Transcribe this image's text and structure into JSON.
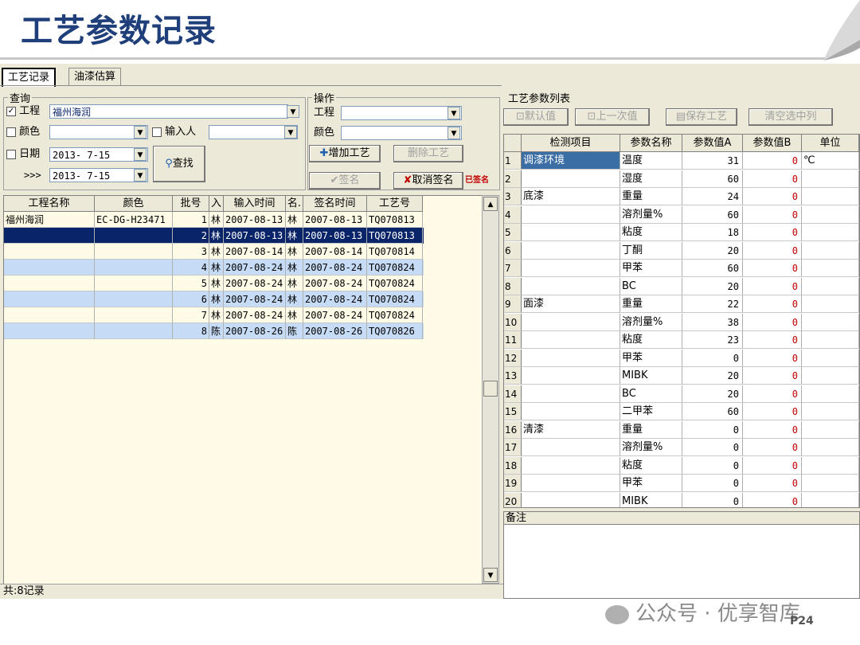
{
  "slide": {
    "title": "工艺参数记录",
    "page": "P24",
    "watermark": "公众号 · 优享智库"
  },
  "tabs": [
    {
      "label": "工艺记录",
      "active": true
    },
    {
      "label": "油漆估算",
      "active": false
    }
  ],
  "query": {
    "legend": "查询",
    "project_label": "工程",
    "project_checked": true,
    "project_value": "福州海润",
    "color_label": "颜色",
    "color_value": "",
    "input_person_label": "输入人",
    "input_person_value": "",
    "date_label": "日期",
    "date_from": "2013- 7-15",
    "date_to_prefix": ">>>",
    "date_to": "2013- 7-15",
    "search_button": "查找"
  },
  "ops": {
    "legend": "操作",
    "project_label": "工程",
    "project_value": "",
    "color_label": "颜色",
    "color_value": "",
    "add_button": "增加工艺",
    "delete_button": "删除工艺",
    "sign_button": "签名",
    "cancel_sign_button": "取消签名",
    "stamp_text": "已签名"
  },
  "left_grid": {
    "columns": [
      "工程名称",
      "颜色",
      "批号",
      "入",
      "输入时间",
      "名.",
      "签名时间",
      "工艺号"
    ],
    "rows": [
      [
        "福州海润",
        "EC-DG-H23471",
        "1",
        "林",
        "2007-08-13",
        "林",
        "2007-08-13",
        "TQ070813"
      ],
      [
        "",
        "",
        "2",
        "林",
        "2007-08-13",
        "林",
        "2007-08-13",
        "TQ070813"
      ],
      [
        "",
        "",
        "3",
        "林",
        "2007-08-14",
        "林",
        "2007-08-14",
        "TQ070814"
      ],
      [
        "",
        "",
        "4",
        "林",
        "2007-08-24",
        "林",
        "2007-08-24",
        "TQ070824"
      ],
      [
        "",
        "",
        "5",
        "林",
        "2007-08-24",
        "林",
        "2007-08-24",
        "TQ070824"
      ],
      [
        "",
        "",
        "6",
        "林",
        "2007-08-24",
        "林",
        "2007-08-24",
        "TQ070824"
      ],
      [
        "",
        "",
        "7",
        "林",
        "2007-08-24",
        "林",
        "2007-08-24",
        "TQ070824"
      ],
      [
        "",
        "",
        "8",
        "陈",
        "2007-08-26",
        "陈",
        "2007-08-26",
        "TQ070826"
      ]
    ],
    "selected_row": 2
  },
  "status": "共:8记录",
  "param_list": {
    "legend": "工艺参数列表",
    "default_button": "默认值",
    "previous_button": "上一次值",
    "save_button": "保存工艺",
    "clear_button": "清空选中列",
    "columns": [
      "",
      "检测项目",
      "参数名称",
      "参数值A",
      "参数值B",
      "单位"
    ],
    "rows": [
      [
        "1",
        "调漆环境",
        "温度",
        "31",
        "0",
        "℃"
      ],
      [
        "2",
        "",
        "湿度",
        "60",
        "0",
        ""
      ],
      [
        "3",
        "底漆",
        "重量",
        "24",
        "0",
        ""
      ],
      [
        "4",
        "",
        "溶剂量%",
        "60",
        "0",
        ""
      ],
      [
        "5",
        "",
        "粘度",
        "18",
        "0",
        ""
      ],
      [
        "6",
        "",
        "丁酮",
        "20",
        "0",
        ""
      ],
      [
        "7",
        "",
        "甲苯",
        "60",
        "0",
        ""
      ],
      [
        "8",
        "",
        "BC",
        "20",
        "0",
        ""
      ],
      [
        "9",
        "面漆",
        "重量",
        "22",
        "0",
        ""
      ],
      [
        "10",
        "",
        "溶剂量%",
        "38",
        "0",
        ""
      ],
      [
        "11",
        "",
        "粘度",
        "23",
        "0",
        ""
      ],
      [
        "12",
        "",
        "甲苯",
        "0",
        "0",
        ""
      ],
      [
        "13",
        "",
        "MIBK",
        "20",
        "0",
        ""
      ],
      [
        "14",
        "",
        "BC",
        "20",
        "0",
        ""
      ],
      [
        "15",
        "",
        "二甲苯",
        "60",
        "0",
        ""
      ],
      [
        "16",
        "清漆",
        "重量",
        "0",
        "0",
        ""
      ],
      [
        "17",
        "",
        "溶剂量%",
        "0",
        "0",
        ""
      ],
      [
        "18",
        "",
        "粘度",
        "0",
        "0",
        ""
      ],
      [
        "19",
        "",
        "甲苯",
        "0",
        "0",
        ""
      ],
      [
        "20",
        "",
        "MIBK",
        "0",
        "0",
        ""
      ]
    ]
  },
  "notes": {
    "label": "备注"
  }
}
